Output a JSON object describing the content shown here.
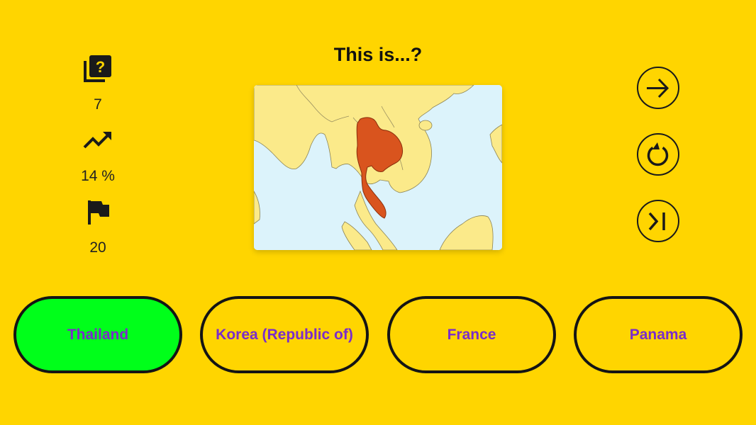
{
  "stats": {
    "questions": {
      "icon": "question-library-icon",
      "value": "7"
    },
    "success_rate": {
      "icon": "trending-up-icon",
      "value": "14 %"
    },
    "total": {
      "icon": "flag-icon",
      "value": "20"
    }
  },
  "question": {
    "title": "This is...?",
    "map_icon": "country-map-thailand"
  },
  "controls": {
    "next": "arrow-right-icon",
    "restart": "refresh-icon",
    "skip": "skip-next-icon"
  },
  "answers": [
    {
      "label": "Thailand",
      "state": "correct"
    },
    {
      "label": "Korea (Republic of)",
      "state": "default"
    },
    {
      "label": "France",
      "state": "default"
    },
    {
      "label": "Panama",
      "state": "default"
    }
  ],
  "colors": {
    "background": "#FFD500",
    "correct_fill": "#00FF1A",
    "answer_text": "#7A2CCB",
    "highlight_country": "#D9541E",
    "land": "#FBEA8A",
    "sea": "#DCF3FB"
  }
}
